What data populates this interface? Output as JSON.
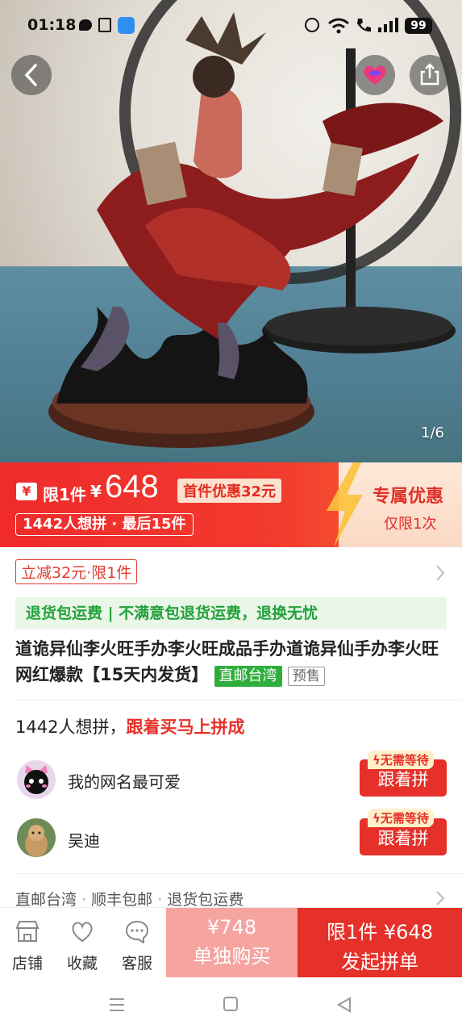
{
  "status": {
    "time": "01:18",
    "battery": "99"
  },
  "gallery": {
    "counter": "1/6"
  },
  "promo": {
    "limit_label": "限1件",
    "currency": "¥",
    "price": "648",
    "first_coupon": "首件优惠32元",
    "want_count": "1442人想拼 · 最后15件",
    "exclusive_title": "专属优惠",
    "exclusive_sub": "仅限1次"
  },
  "coupon": {
    "label": "立减32元·限1件"
  },
  "service_bar": {
    "text": "退货包运费 | 不满意包退货运费，退换无忧"
  },
  "product": {
    "title": "道诡异仙李火旺手办李火旺成品手办道诡异仙手办李火旺网红爆款【15天内发货】",
    "badge_direct": "直邮台湾",
    "badge_presale": "预售"
  },
  "group": {
    "count_text": "1442人想拼，",
    "cta_text": "跟着买马上拼成",
    "users": [
      {
        "name": "我的网名最可爱",
        "badge": "无需等待",
        "button": "跟着拼"
      },
      {
        "name": "吴迪",
        "badge": "无需等待",
        "button": "跟着拼"
      }
    ]
  },
  "shipping": {
    "items": [
      "直邮台湾",
      "顺丰包邮",
      "退货包运费"
    ]
  },
  "bottom_bar": {
    "tabs": [
      {
        "icon": "store-icon",
        "label": "店铺"
      },
      {
        "icon": "heart-icon",
        "label": "收藏"
      },
      {
        "icon": "chat-icon",
        "label": "客服"
      }
    ],
    "solo_price": "¥748",
    "solo_label": "单独购买",
    "group_price": "限1件 ¥648",
    "group_label": "发起拼单"
  },
  "colors": {
    "accent_red": "#e5312a",
    "green": "#2fae3c",
    "promo_red": "#ef2b2b"
  }
}
